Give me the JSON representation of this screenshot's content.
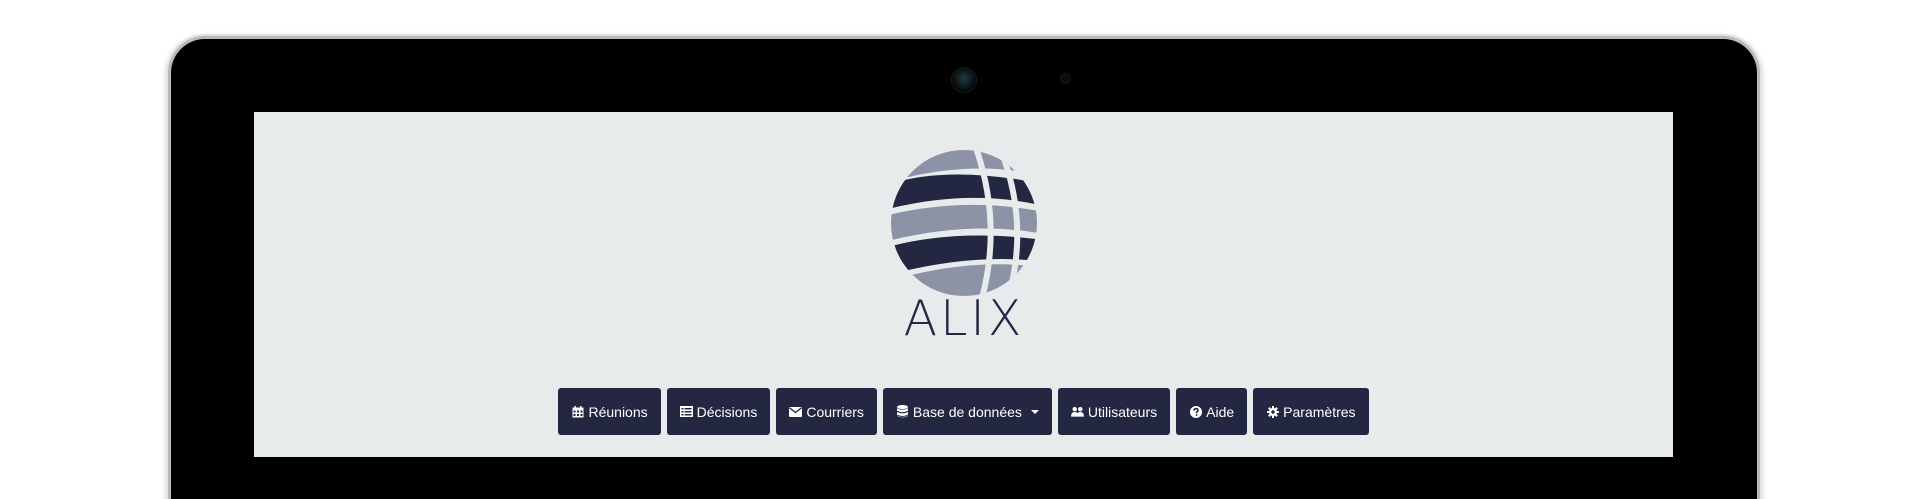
{
  "brand": {
    "logo_text": "ALIX",
    "colors": {
      "dark": "#232742",
      "light": "#8c93a6",
      "screen_bg": "#e7ebec"
    }
  },
  "nav": {
    "items": [
      {
        "label": "Réunions",
        "icon": "calendar-icon"
      },
      {
        "label": "Décisions",
        "icon": "list-icon"
      },
      {
        "label": "Courriers",
        "icon": "envelope-icon"
      },
      {
        "label": "Base de données",
        "icon": "database-icon",
        "dropdown": true
      },
      {
        "label": "Utilisateurs",
        "icon": "users-icon"
      },
      {
        "label": "Aide",
        "icon": "question-circle-icon"
      },
      {
        "label": "Paramètres",
        "icon": "gear-icon"
      }
    ]
  }
}
